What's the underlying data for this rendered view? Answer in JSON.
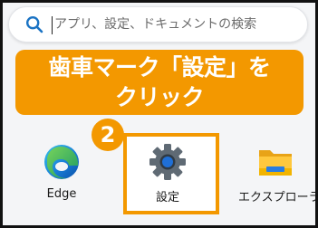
{
  "search": {
    "placeholder": "アプリ、設定、ドキュメントの検索"
  },
  "banner": {
    "line1": "歯車マーク「設定」を",
    "line2": "クリック"
  },
  "step_badge": "2",
  "apps": {
    "edge": {
      "label": "Edge",
      "icon": "edge-icon"
    },
    "settings": {
      "label": "設定",
      "icon": "gear-icon"
    },
    "explorer": {
      "label": "エクスプローラー",
      "icon": "folder-icon"
    }
  },
  "colors": {
    "accent": "#f39800",
    "search_icon": "#1a73c4"
  }
}
